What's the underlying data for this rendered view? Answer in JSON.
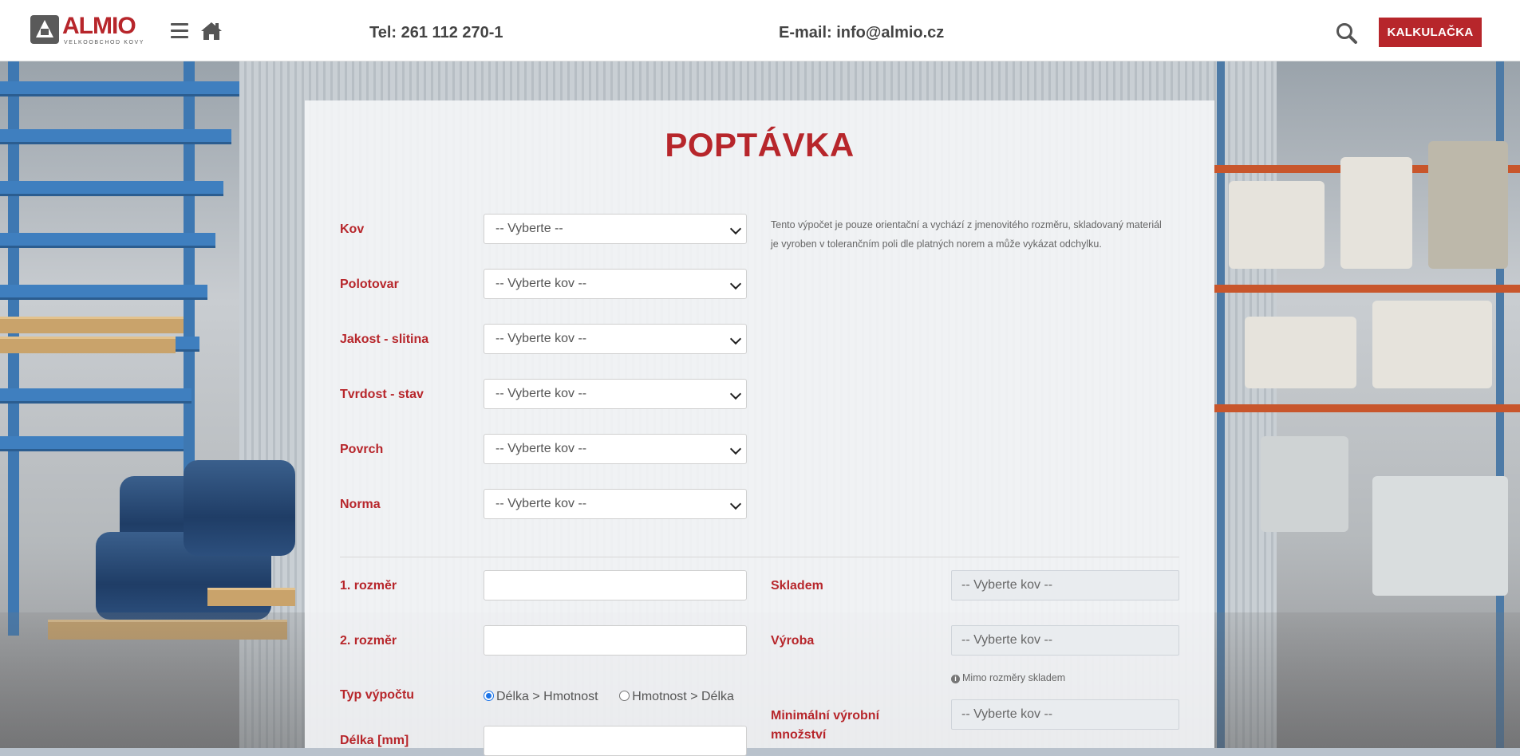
{
  "header": {
    "logo_text": "ALMIO",
    "logo_subtitle": "VELKOOBCHOD KOVY",
    "phone": "Tel: 261 112 270-1",
    "email": "E-mail: info@almio.cz",
    "calc_button": "KALKULAČKA",
    "icons": [
      "menu-icon",
      "home-icon",
      "search-icon"
    ]
  },
  "form": {
    "title": "POPTÁVKA",
    "note": "Tento výpočet je pouze orientační a vychází z jmenovitého rozměru, skladovaný materiál je vyroben v tolerančním poli dle platných norem a může vykázat odchylku.",
    "fields": [
      {
        "label": "Kov",
        "value": "-- Vyberte --"
      },
      {
        "label": "Polotovar",
        "value": "-- Vyberte kov --"
      },
      {
        "label": "Jakost - slitina",
        "value": "-- Vyberte kov --"
      },
      {
        "label": "Tvrdost - stav",
        "value": "-- Vyberte kov --"
      },
      {
        "label": "Povrch",
        "value": "-- Vyberte kov --"
      },
      {
        "label": "Norma",
        "value": "-- Vyberte kov --"
      }
    ],
    "dim1_label": "1. rozměr",
    "dim2_label": "2. rozměr",
    "calc_type_label": "Typ výpočtu",
    "radio_options": [
      "Délka > Hmotnost",
      "Hmotnost > Délka"
    ],
    "radio_selected": "Délka > Hmotnost",
    "length_label": "Délka [mm]",
    "stock_label": "Skladem",
    "stock_value": "-- Vyberte kov --",
    "production_label": "Výroba",
    "production_value": "-- Vyberte kov --",
    "out_of_stock_hint": "Mimo rozměry skladem",
    "min_qty_label": "Minimální výrobní množství",
    "min_qty_value": "-- Vyberte kov --"
  },
  "colors": {
    "brand_red": "#b7262b",
    "text_gray": "#444444"
  }
}
